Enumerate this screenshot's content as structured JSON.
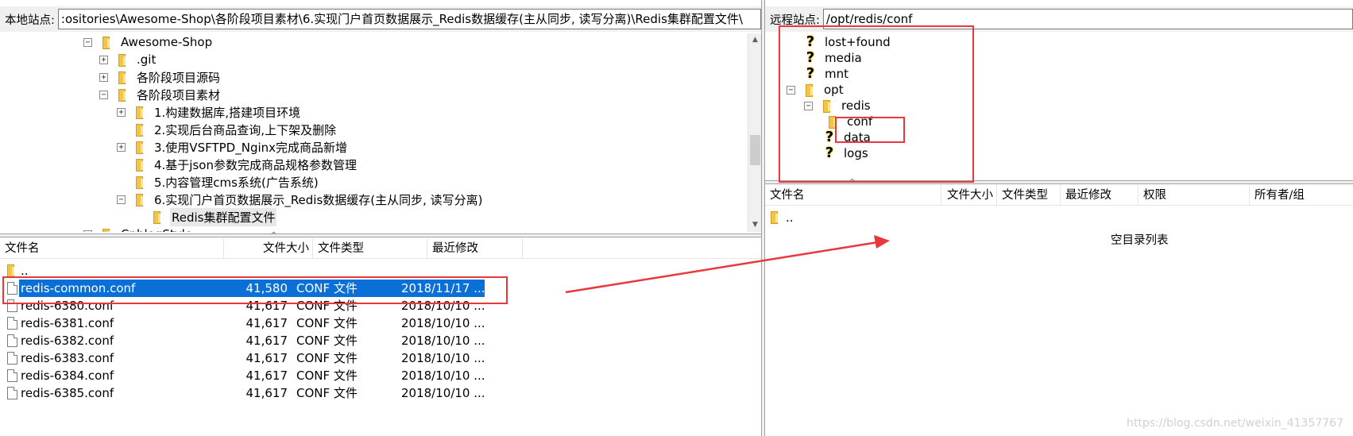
{
  "local": {
    "site_label": "本地站点:",
    "site_path": ":ositories\\Awesome-Shop\\各阶段项目素材\\6.实现门户首页数据展示_Redis数据缓存(主从同步, 读写分离)\\Redis集群配置文件\\",
    "tree": [
      {
        "label": "Awesome-Shop",
        "expander": "⊟"
      },
      {
        "label": ".git",
        "expander": "⊞"
      },
      {
        "label": "各阶段项目源码",
        "expander": "⊞"
      },
      {
        "label": "各阶段项目素材",
        "expander": "⊟"
      },
      {
        "label": "1.构建数据库,搭建项目环境",
        "expander": "⊞"
      },
      {
        "label": "2.实现后台商品查询,上下架及删除",
        "expander": ""
      },
      {
        "label": "3.使用VSFTPD_Nginx完成商品新增",
        "expander": "⊞"
      },
      {
        "label": "4.基于json参数完成商品规格参数管理",
        "expander": ""
      },
      {
        "label": "5.内容管理cms系统(广告系统)",
        "expander": ""
      },
      {
        "label": "6.实现门户首页数据展示_Redis数据缓存(主从同步, 读写分离)",
        "expander": "⊟"
      },
      {
        "label": "Redis集群配置文件",
        "expander": ""
      },
      {
        "label": "CnblogStyle",
        "expander": "⊞"
      }
    ],
    "headers": [
      "文件名",
      "文件大小",
      "文件类型",
      "最近修改"
    ],
    "parent_dir": "..",
    "files": [
      {
        "name": "redis-common.conf",
        "size": "41,580",
        "type": "CONF 文件",
        "modified": "2018/11/17 ...",
        "selected": true
      },
      {
        "name": "redis-6380.conf",
        "size": "41,617",
        "type": "CONF 文件",
        "modified": "2018/10/10 ...",
        "selected": false
      },
      {
        "name": "redis-6381.conf",
        "size": "41,617",
        "type": "CONF 文件",
        "modified": "2018/10/10 ...",
        "selected": false
      },
      {
        "name": "redis-6382.conf",
        "size": "41,617",
        "type": "CONF 文件",
        "modified": "2018/10/10 ...",
        "selected": false
      },
      {
        "name": "redis-6383.conf",
        "size": "41,617",
        "type": "CONF 文件",
        "modified": "2018/10/10 ...",
        "selected": false
      },
      {
        "name": "redis-6384.conf",
        "size": "41,617",
        "type": "CONF 文件",
        "modified": "2018/10/10 ...",
        "selected": false
      },
      {
        "name": "redis-6385.conf",
        "size": "41,617",
        "type": "CONF 文件",
        "modified": "2018/10/10 ...",
        "selected": false
      }
    ]
  },
  "remote": {
    "site_label": "远程站点:",
    "site_path": "/opt/redis/conf",
    "tree": [
      {
        "label": "lost+found",
        "icon": "question"
      },
      {
        "label": "media",
        "icon": "question"
      },
      {
        "label": "mnt",
        "icon": "question"
      },
      {
        "label": "opt",
        "icon": "folder",
        "expander": "⊟"
      },
      {
        "label": "redis",
        "icon": "folder",
        "expander": "⊟"
      },
      {
        "label": "conf",
        "icon": "folder"
      },
      {
        "label": "data",
        "icon": "question"
      },
      {
        "label": "logs",
        "icon": "question"
      }
    ],
    "headers": [
      "文件名",
      "文件大小",
      "文件类型",
      "最近修改",
      "权限",
      "所有者/组"
    ],
    "parent_dir": "..",
    "empty_text": "空目录列表"
  },
  "watermark": "https://blog.csdn.net/weixin_41357767",
  "colors": {
    "selection": "#0a6fd6",
    "annotation": "#e8383d",
    "folder": "#f3c44b"
  }
}
